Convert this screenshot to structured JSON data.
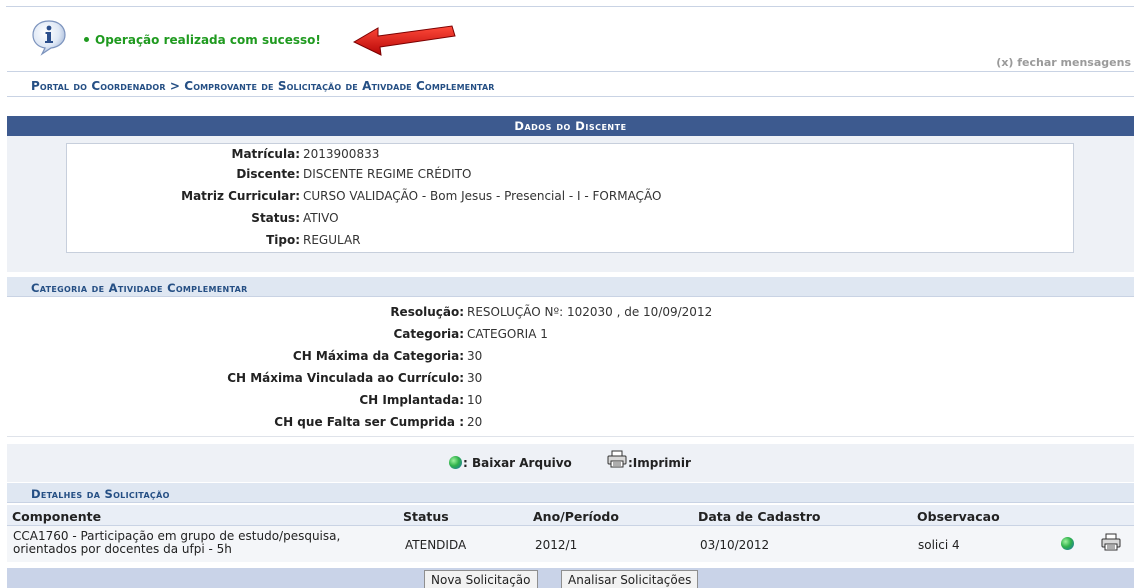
{
  "message": {
    "text": "Operação realizada com sucesso!",
    "close_label": "(x) fechar mensagens"
  },
  "breadcrumb": {
    "text": "Portal do Coordenador > Comprovante de Solicitação de Ativdade Complementar"
  },
  "dados_discente": {
    "title": "Dados do Discente",
    "fields": [
      {
        "label": "Matrícula:",
        "value": "2013900833"
      },
      {
        "label": "Discente:",
        "value": "DISCENTE REGIME CRÉDITO"
      },
      {
        "label": "Matriz Curricular:",
        "value": "CURSO VALIDAÇÃO - Bom Jesus - Presencial - I - FORMAÇÃO"
      },
      {
        "label": "Status:",
        "value": "ATIVO"
      },
      {
        "label": "Tipo:",
        "value": "REGULAR"
      }
    ]
  },
  "categoria": {
    "title": "Categoria de Atividade Complementar",
    "fields": [
      {
        "label": "Resolução:",
        "value": "RESOLUÇÃO Nº: 102030 , de 10/09/2012"
      },
      {
        "label": "Categoria:",
        "value": "CATEGORIA 1"
      },
      {
        "label": "CH Máxima da Categoria:",
        "value": "30"
      },
      {
        "label": "CH Máxima Vinculada ao Currículo:",
        "value": "30"
      },
      {
        "label": "CH Implantada:",
        "value": "10"
      },
      {
        "label": "CH que Falta ser Cumprida :",
        "value": "20"
      }
    ]
  },
  "legend": {
    "download_label": ": Baixar Arquivo",
    "print_label": ":Imprimir"
  },
  "detalhes": {
    "title": "Detalhes da Solicitação",
    "columns": [
      "Componente",
      "Status",
      "Ano/Período",
      "Data de Cadastro",
      "Observacao"
    ],
    "rows": [
      {
        "componente_line1": "CCA1760 - Participação em grupo de estudo/pesquisa,",
        "componente_line2": "orientados por docentes da ufpi - 5h",
        "status": "ATENDIDA",
        "ano_periodo": "2012/1",
        "data_cadastro": "03/10/2012",
        "observacao": "solici 4"
      }
    ]
  },
  "buttons": {
    "nova": "Nova Solicitação",
    "analisar": "Analisar Solicitações"
  },
  "colors": {
    "success": "#1f9a1f",
    "header_dark": "#3d5a8f",
    "section_title": "#254f84",
    "arrow": "#e01010"
  }
}
